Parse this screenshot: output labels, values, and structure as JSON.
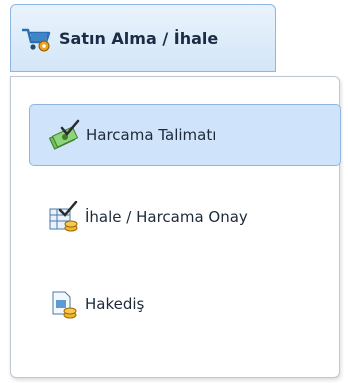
{
  "menu": {
    "label": "Satın Alma / İhale",
    "icon": "shopping-cart-icon",
    "accent_color": "#8fb6e0"
  },
  "dropdown": {
    "items": [
      {
        "label": "Harcama Talimatı",
        "icon": "money-check-icon",
        "active": true
      },
      {
        "label": "İhale / Harcama Onay",
        "icon": "approval-table-icon",
        "active": false
      },
      {
        "label": "Hakediş",
        "icon": "payment-document-icon",
        "active": false
      }
    ]
  }
}
